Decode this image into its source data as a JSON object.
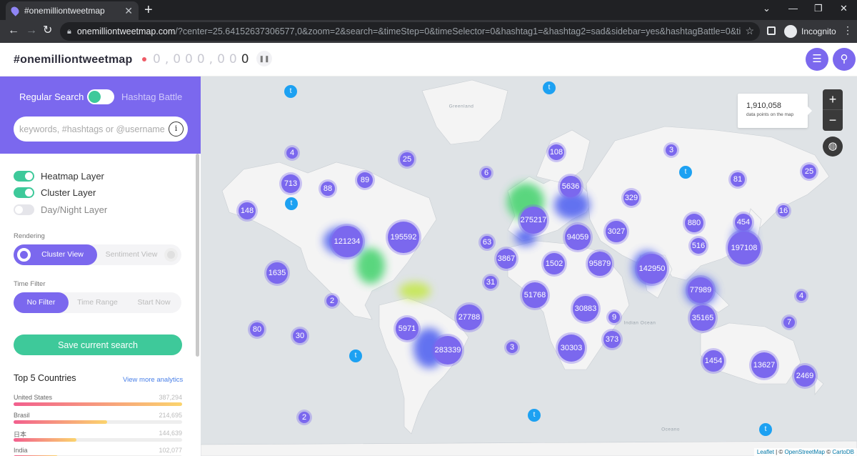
{
  "browser": {
    "tab_title": "#onemilliontweetmap",
    "url_host": "onemilliontweetmap.com",
    "url_rest": "/?center=25.64152637306577,0&zoom=2&search=&timeStep=0&timeSelector=0&hashtag1=&hashtag2=sad&sidebar=yes&hashtagBattle=0&timeRange=0&time...",
    "profile_label": "Incognito"
  },
  "header": {
    "brand": "#onemilliontweetmap",
    "counter_faded": "0,000,00",
    "counter_last": "0"
  },
  "search": {
    "regular_label": "Regular Search",
    "battle_label": "Hashtag Battle",
    "placeholder": "keywords, #hashtags or @username"
  },
  "layers": [
    {
      "label": "Heatmap Layer",
      "on": true
    },
    {
      "label": "Cluster Layer",
      "on": true
    },
    {
      "label": "Day/Night Layer",
      "on": false
    }
  ],
  "rendering": {
    "label": "Rendering",
    "options": [
      "Cluster View",
      "Sentiment View"
    ],
    "selected": "Cluster View"
  },
  "time_filter": {
    "label": "Time Filter",
    "options": [
      "No Filter",
      "Time Range",
      "Start Now"
    ],
    "selected": "No Filter"
  },
  "save_label": "Save current search",
  "top_countries": {
    "title": "Top 5 Countries",
    "more_label": "View more analytics",
    "items": [
      {
        "name": "United States",
        "value": "387,294",
        "share": 1.0
      },
      {
        "name": "Brasil",
        "value": "214,695",
        "share": 0.554
      },
      {
        "name": "日本",
        "value": "144,639",
        "share": 0.373
      },
      {
        "name": "India",
        "value": "102,077",
        "share": 0.264
      }
    ]
  },
  "map": {
    "data_points_value": "1,910,058",
    "data_points_label": "data points on the map",
    "zoom_in": "+",
    "zoom_out": "−",
    "attribution_leaflet": "Leaflet",
    "attribution_osm": "OpenStreetMap",
    "attribution_carto": "CartoDB",
    "ocean_labels": [
      "Greenland",
      "Indian Ocean",
      "Oceano"
    ],
    "clusters": [
      "4",
      "25",
      "108",
      "3",
      "713",
      "88",
      "89",
      "6",
      "5636",
      "329",
      "81",
      "25",
      "148",
      "16",
      "275217",
      "880",
      "454",
      "121234",
      "195592",
      "63",
      "94059",
      "3027",
      "197108",
      "3867",
      "516",
      "1502",
      "95879",
      "142950",
      "1635",
      "31",
      "77989",
      "51768",
      "4",
      "2",
      "30883",
      "9",
      "35165",
      "27788",
      "7",
      "80",
      "30",
      "5971",
      "373",
      "3",
      "283339",
      "30303",
      "1454",
      "13627",
      "2469",
      "2"
    ],
    "accent_color": "#7b68ee",
    "toggle_color": "#3ec99a"
  }
}
